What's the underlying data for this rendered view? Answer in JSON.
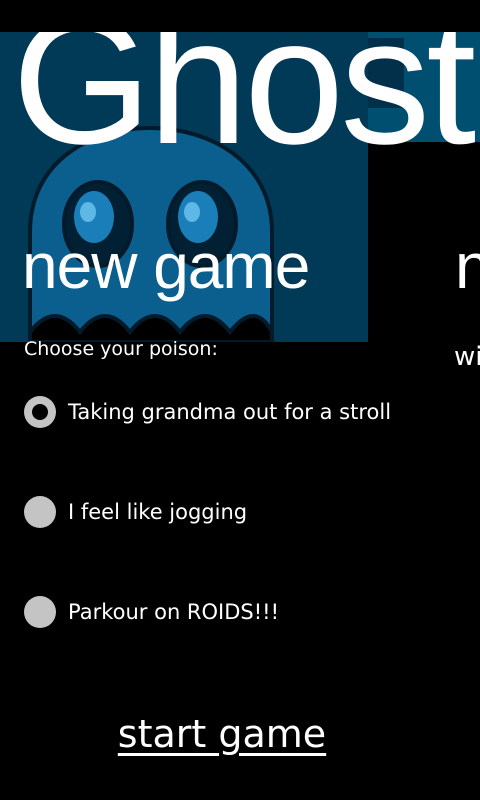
{
  "app": {
    "title": "Ghost"
  },
  "pivot": {
    "active_header": "new game",
    "next_header": "n",
    "next_content_preview": "wi"
  },
  "new_game": {
    "prompt": "Choose your poison:",
    "options": [
      {
        "label": "Taking grandma out for a stroll",
        "selected": true
      },
      {
        "label": "I feel like jogging",
        "selected": false
      },
      {
        "label": "Parkour on ROIDS!!!",
        "selected": false
      }
    ],
    "start_label": "start game"
  },
  "colors": {
    "background": "#000000",
    "art_panel_dark": "#003a56",
    "art_panel_light": "#014f70",
    "ghost_body": "#0b5f8e",
    "ghost_outline": "#021a2a",
    "radio_fill": "#c4c4c4",
    "text": "#ffffff"
  },
  "icons": {
    "background": "ghost-character-art",
    "radio": "radio-button-icon"
  }
}
